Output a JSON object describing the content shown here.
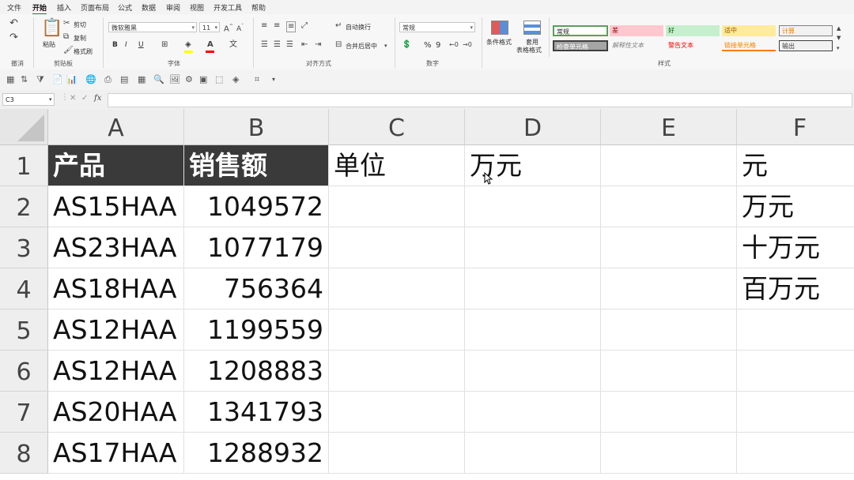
{
  "menu": {
    "tabs": [
      "文件",
      "开始",
      "插入",
      "页面布局",
      "公式",
      "数据",
      "审阅",
      "视图",
      "开发工具",
      "帮助"
    ],
    "active_index": 1
  },
  "ribbon": {
    "undo_group": "撤消",
    "clipboard": {
      "paste": "粘贴",
      "cut": "剪切",
      "copy": "复制",
      "format_painter": "格式刷",
      "label": "剪贴板"
    },
    "font": {
      "name": "微软雅黑",
      "size": "11",
      "label": "字体",
      "bold": "B",
      "italic": "I",
      "underline": "U"
    },
    "alignment": {
      "wrap": "自动换行",
      "merge": "合并后居中",
      "label": "对齐方式"
    },
    "number": {
      "format": "常规",
      "percent": "%",
      "comma": "9",
      "label": "数字"
    },
    "styles": {
      "conditional": "条件格式",
      "table_format_1": "套用",
      "table_format_2": "表格格式",
      "label": "样式",
      "cells": [
        {
          "text": "常规",
          "bg": "#ffffff",
          "fg": "#222222",
          "border": "#5aa05a"
        },
        {
          "text": "差",
          "bg": "#ffc7ce",
          "fg": "#9c0006",
          "border": "#ffc7ce"
        },
        {
          "text": "好",
          "bg": "#c6efce",
          "fg": "#006100",
          "border": "#c6efce"
        },
        {
          "text": "适中",
          "bg": "#ffeb9c",
          "fg": "#9c5700",
          "border": "#ffeb9c"
        },
        {
          "text": "计算",
          "bg": "#f2f2f2",
          "fg": "#fa7d00",
          "border": "#7f7f7f"
        },
        {
          "text": "检查单元格",
          "bg": "#a5a5a5",
          "fg": "#ffffff",
          "border": "#3f3f3f"
        },
        {
          "text": "解释性文本",
          "bg": "#f7f7f7",
          "fg": "#7f7f7f",
          "border": "#f7f7f7"
        },
        {
          "text": "警告文本",
          "bg": "#f7f7f7",
          "fg": "#ff0000",
          "border": "#f7f7f7"
        },
        {
          "text": "链接单元格",
          "bg": "#f7f7f7",
          "fg": "#fa7d00",
          "border": "#f7f7f7"
        },
        {
          "text": "输出",
          "bg": "#f2f2f2",
          "fg": "#3f3f3f",
          "border": "#3f3f3f"
        }
      ]
    }
  },
  "formula_bar": {
    "name_box": "C3",
    "fx": "fx",
    "cancel": "✕",
    "confirm": "✓",
    "formula": ""
  },
  "columns": [
    "A",
    "B",
    "C",
    "D",
    "E",
    "F"
  ],
  "rows": [
    "1",
    "2",
    "3",
    "4",
    "5",
    "6",
    "7",
    "8"
  ],
  "cells": {
    "A1": "产品",
    "B1": "销售额",
    "C1": "单位",
    "D1": "万元",
    "F1": "元",
    "A2": "AS15HAA",
    "B2": "1049572",
    "F2": "万元",
    "A3": "AS23HAA",
    "B3": "1077179",
    "F3": "十万元",
    "A4": "AS18HAA",
    "B4": "756364",
    "F4": "百万元",
    "A5": "AS12HAA",
    "B5": "1199559",
    "A6": "AS12HAA",
    "B6": "1208883",
    "A7": "AS20HAA",
    "B7": "1341793",
    "A8": "AS17HAA",
    "B8": "1288932"
  },
  "colors": {
    "accent": "#217346",
    "header_fill": "#3a3a3a"
  }
}
